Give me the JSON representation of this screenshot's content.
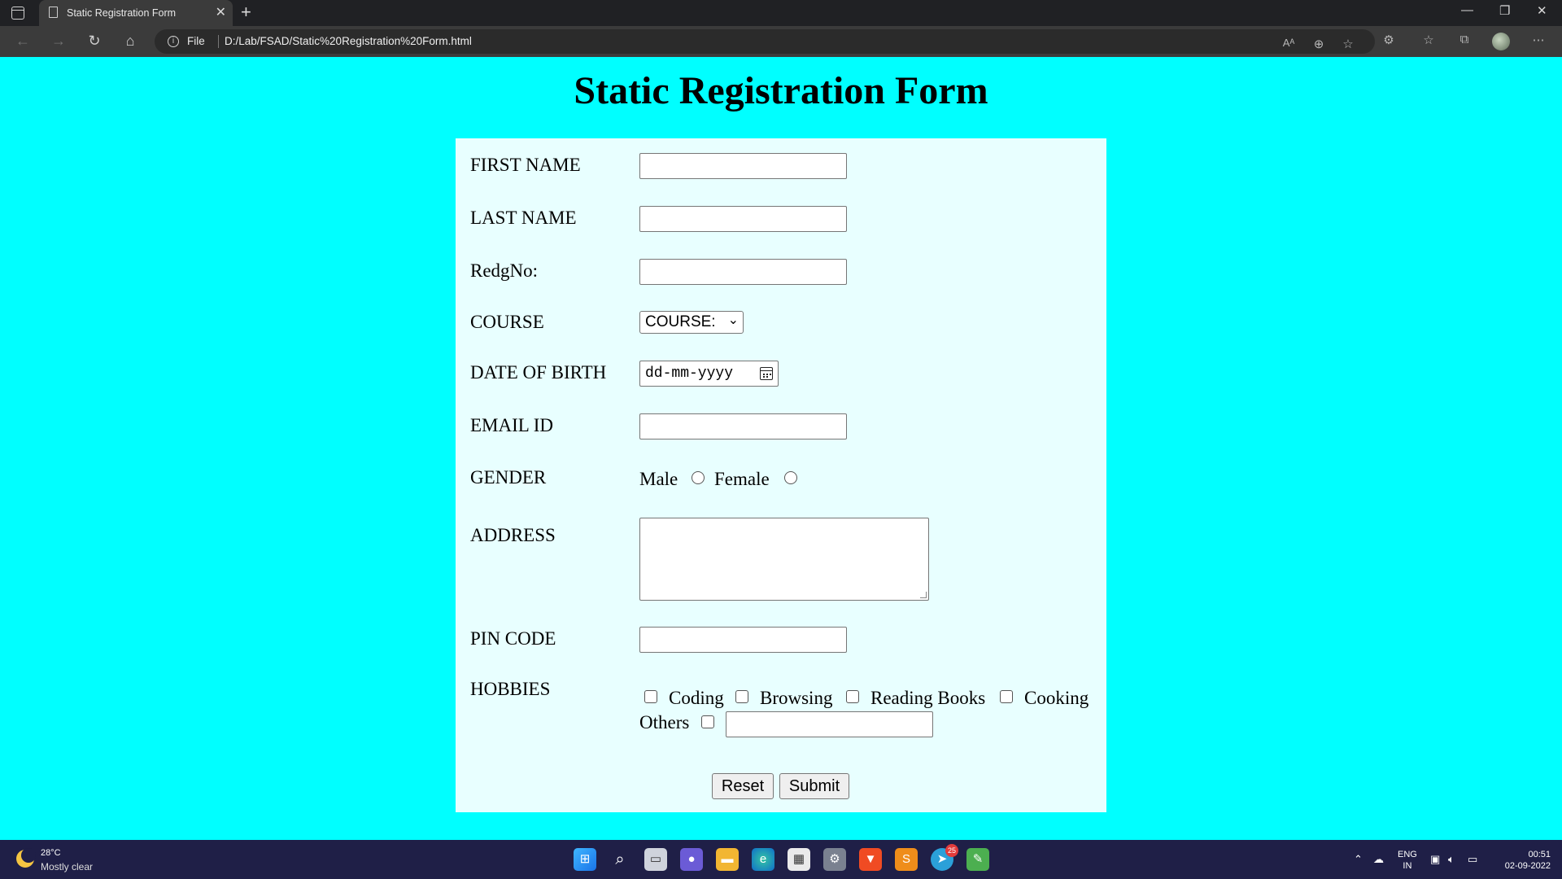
{
  "browser": {
    "tab_title": "Static Registration Form",
    "tab_close": "✕",
    "new_tab": "+",
    "scheme_label": "File",
    "url": "D:/Lab/FSAD/Static%20Registration%20Form.html"
  },
  "page": {
    "title": "Static Registration Form",
    "labels": {
      "first_name": "FIRST NAME",
      "last_name": "LAST NAME",
      "regd_no": "RedgNo:",
      "course": "COURSE",
      "dob": "DATE OF BIRTH",
      "email": "EMAIL ID",
      "gender": "GENDER",
      "address": "ADDRESS",
      "pin_code": "PIN CODE",
      "hobbies": "HOBBIES"
    },
    "fields": {
      "first_name": "",
      "last_name": "",
      "regd_no": "",
      "email": "",
      "pin_code": "",
      "address": "",
      "others_text": ""
    },
    "course_selected": "COURSE:",
    "dob_placeholder": "dd-mm-yyyy",
    "gender_options": [
      "Male",
      "Female"
    ],
    "hobbies_options": [
      "Coding",
      "Browsing",
      "Reading Books",
      "Cooking",
      "Others"
    ],
    "buttons": {
      "reset": "Reset",
      "submit": "Submit"
    }
  },
  "taskbar": {
    "weather_temp": "28°C",
    "weather_desc": "Mostly clear",
    "telegram_badge": "25",
    "lang_line1": "ENG",
    "lang_line2": "IN",
    "time": "00:51",
    "date": "02-09-2022"
  }
}
